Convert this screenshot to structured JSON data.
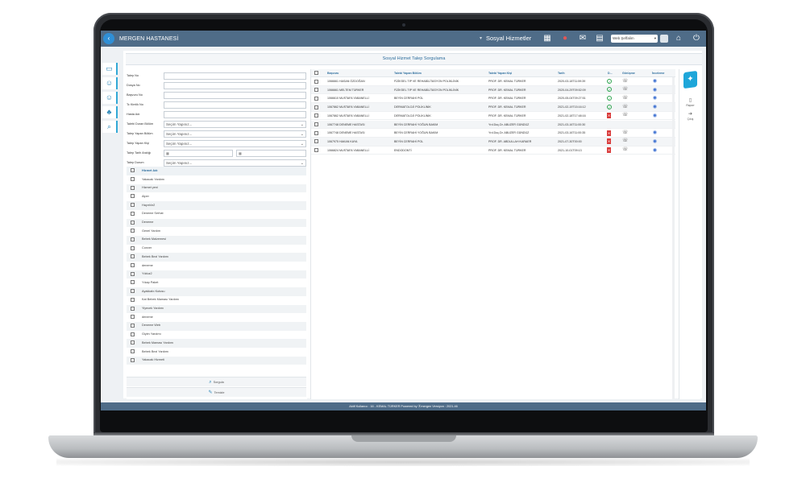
{
  "topbar": {
    "hospital_name": "MERGEN HASTANESİ",
    "module_name": "Sosyal Hizmetler",
    "language": "Web Şeffalim"
  },
  "page": {
    "title": "Sosyal Hizmet Talep Sorgulama"
  },
  "form": {
    "fields": [
      {
        "label": "Talep No"
      },
      {
        "label": "Dosya No"
      },
      {
        "label": "Başvuru No"
      },
      {
        "label": "Tc Kimlik No"
      },
      {
        "label": "Hasta Adı"
      }
    ],
    "selects": [
      {
        "label": "Talebi Duran Bölüm",
        "value": "Seçim Yapınız..."
      },
      {
        "label": "Talep Yapan Bölüm",
        "value": "Seçim Yapınız..."
      },
      {
        "label": "Talep Yapan Kişi",
        "value": "Seçim Yapınız..."
      }
    ],
    "date_label": "Talep Tarih Aralığı",
    "status": {
      "label": "Talep Durum",
      "value": "Seçim Yapınız..."
    },
    "services_header": "Hizmet Adı",
    "services": [
      "Yakacak Yardımı",
      "Hizmet yeni",
      "Alper",
      "Hayırlılır2",
      "Deneme Serhat",
      "Deneme",
      "Genel Yardım",
      "Bebek Malzemesi",
      "Conver",
      "Bebek Bezi Yardımı",
      "deneme",
      "Yılduz2",
      "Yıkap Paket",
      "Ayakkabı Kutusu",
      "Kat Bebek Maması Yardımı",
      "Yiyecek Yardımı",
      "deneme",
      "Deneme Web",
      "Giyim Yardımı",
      "Bebek Maması Yardımı",
      "Bebek Bezi Yardımı",
      "Yakacak Hizmeti"
    ],
    "search_label": "Sorgula",
    "clear_label": "Temizle"
  },
  "grid": {
    "headers": {
      "applicant": "Başvuru",
      "dept": "Talebi Yapan Bölüm",
      "person": "Talebi Yapan Kişi",
      "date": "Tarih",
      "status": "D...",
      "view": "Görüşme",
      "review": "İnceleme"
    },
    "rows": [
      {
        "applicant": "1066661 HASAN ÖZDOĞAN",
        "dept": "FİZİKSEL TIP VE REHABİLİTASYON POLİKLİNİK",
        "person": "PROF. DR. KEMAL TÜRKER",
        "date": "2020-03-18T11:59:39",
        "status": "ok"
      },
      {
        "applicant": "1066661 MELTEM TÜRKER",
        "dept": "FİZİKSEL TIP VE REHABİLİTASYON POLİKLİNİK",
        "person": "PROF. DR. KEMAL TÜRKER",
        "date": "2020-04-29T09:52:09",
        "status": "ok"
      },
      {
        "applicant": "1066610 MUSTAFA YABANELLİ",
        "dept": "BEYİN CERRAHİ POL",
        "person": "PROF. DR. KEMAL TÜRKER",
        "date": "2020-05-04T09:27:51",
        "status": "ok"
      },
      {
        "applicant": "1067862 MUSTAFA YABANELLİ",
        "dept": "DERMATOLOJİ POLİKLİNİK",
        "person": "PROF. DR. KEMAL TÜRKER",
        "date": "2021-02-19T15:16:12",
        "status": "ok"
      },
      {
        "applicant": "1067862 MUSTAFA YABANELLİ",
        "dept": "DERMATOLOJİ POLİKLİNİK",
        "person": "PROF. DR. KEMAL TÜRKER",
        "date": "2021-02-18T17:48:16",
        "status": "no"
      },
      {
        "applicant": "1067748 DENEME HASTASI",
        "dept": "BEYİN CERRAHİ YOĞUN BAKIM",
        "person": "Yrd.Doç.Dr. ABUZER GÜNDÜZ",
        "date": "2021-03-16T11:00:30",
        "status": "none"
      },
      {
        "applicant": "1067748 DENEME HASTASI",
        "dept": "BEYİN CERRAHİ YOĞUN BAKIM",
        "person": "Yrd.Doç.Dr. ABUZER GÜNDÜZ",
        "date": "2021-03-16T11:00:35",
        "status": "no"
      },
      {
        "applicant": "1067975 HAKAN KAYA",
        "dept": "BEYİN CERRAHİ POL",
        "person": "PROF. DR. ABDULLAH KARAER",
        "date": "2021-07-30T00:00",
        "status": "no"
      },
      {
        "applicant": "1066824 MUSTAFA YABANELLİ",
        "dept": "ENDODONTİ",
        "person": "PROF. DR. KEMAL TÜRKER",
        "date": "2021-10-01T09:13",
        "status": "no"
      }
    ]
  },
  "rightpanel": {
    "report_label": "Raporr",
    "exit_label": "Çıkış"
  },
  "statusbar": {
    "text": "Aktif Kullanıcı : 16 - KEMAL TÜRKER    Powered by  ⦿mergen   Versiyon : 2021.46"
  }
}
